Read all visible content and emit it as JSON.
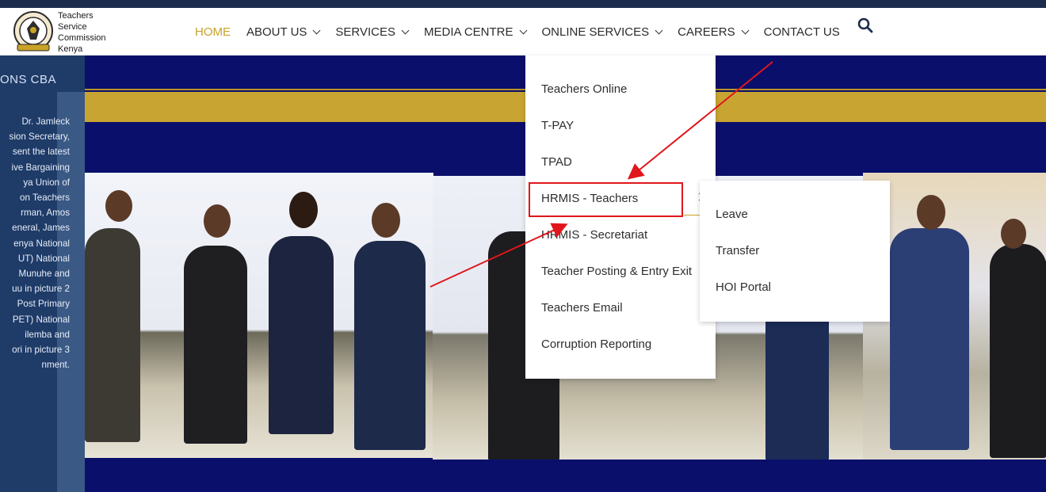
{
  "logo": {
    "lines": [
      "Teachers",
      "Service",
      "Commission",
      "Kenya"
    ]
  },
  "nav": {
    "items": [
      {
        "label": "HOME",
        "has_dropdown": false,
        "active": true
      },
      {
        "label": "ABOUT US",
        "has_dropdown": true
      },
      {
        "label": "SERVICES",
        "has_dropdown": true
      },
      {
        "label": "MEDIA CENTRE",
        "has_dropdown": true
      },
      {
        "label": "ONLINE SERVICES",
        "has_dropdown": true
      },
      {
        "label": "CAREERS",
        "has_dropdown": true
      },
      {
        "label": "CONTACT US",
        "has_dropdown": false
      }
    ],
    "search_icon": "search-icon"
  },
  "slide": {
    "title": "ONS CBA",
    "body_lines": [
      "Dr.   Jamleck",
      "sion  Secretary,",
      "sent the latest",
      "ive Bargaining",
      "ya   Union   of",
      "on     Teachers",
      "rman,     Amos",
      "eneral,   James",
      "enya  National",
      "UT)    National",
      "Munuhe   and",
      "uu in picture 2",
      "Post   Primary",
      "PET)   National",
      "ilemba     and",
      "ori in picture 3",
      "nment."
    ]
  },
  "online_services_menu": {
    "items": [
      "Teachers Online",
      "T-PAY",
      "TPAD",
      "HRMIS - Teachers",
      "HRMIS - Secretariat",
      "Teacher Posting & Entry Exit",
      "Teachers Email",
      "Corruption Reporting"
    ],
    "highlighted": "HRMIS - Teachers"
  },
  "hrmis_submenu": {
    "items": [
      "Leave",
      "Transfer",
      "HOI Portal"
    ]
  },
  "colors": {
    "accent_gold": "#c9a227",
    "navy": "#0a0f6b",
    "annotation_red": "#e0161b"
  }
}
